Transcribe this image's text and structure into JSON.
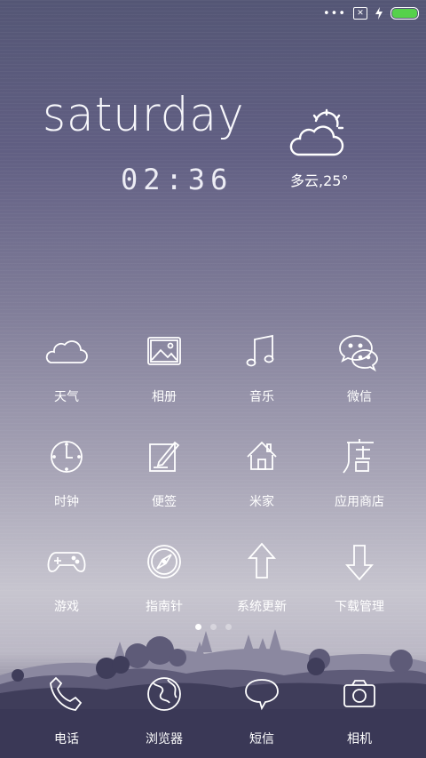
{
  "status_bar": {
    "dots": "•••",
    "sim_icon": "sim-missing-icon",
    "charging_icon": "charging-bolt-icon",
    "battery_icon": "battery-icon",
    "battery_level": 1.0,
    "battery_color": "#56d14b"
  },
  "widget": {
    "day": "saturday",
    "time": "02:36",
    "weather_icon": "partly-cloudy-icon",
    "weather": "多云,25°"
  },
  "apps": [
    {
      "label": "天气",
      "icon": "cloud-icon"
    },
    {
      "label": "相册",
      "icon": "gallery-icon"
    },
    {
      "label": "音乐",
      "icon": "music-note-icon"
    },
    {
      "label": "微信",
      "icon": "wechat-icon"
    },
    {
      "label": "时钟",
      "icon": "clock-icon"
    },
    {
      "label": "便签",
      "icon": "notes-pencil-icon"
    },
    {
      "label": "米家",
      "icon": "home-icon"
    },
    {
      "label": "应用商店",
      "icon": "store-icon"
    },
    {
      "label": "游戏",
      "icon": "gamepad-icon"
    },
    {
      "label": "指南针",
      "icon": "compass-icon"
    },
    {
      "label": "系统更新",
      "icon": "arrow-up-icon"
    },
    {
      "label": "下载管理",
      "icon": "arrow-down-icon"
    }
  ],
  "pager": {
    "pages": 3,
    "current": 1
  },
  "dock": [
    {
      "label": "电话",
      "icon": "phone-icon"
    },
    {
      "label": "浏览器",
      "icon": "globe-icon"
    },
    {
      "label": "短信",
      "icon": "chat-bubble-icon"
    },
    {
      "label": "相机",
      "icon": "camera-icon"
    }
  ]
}
